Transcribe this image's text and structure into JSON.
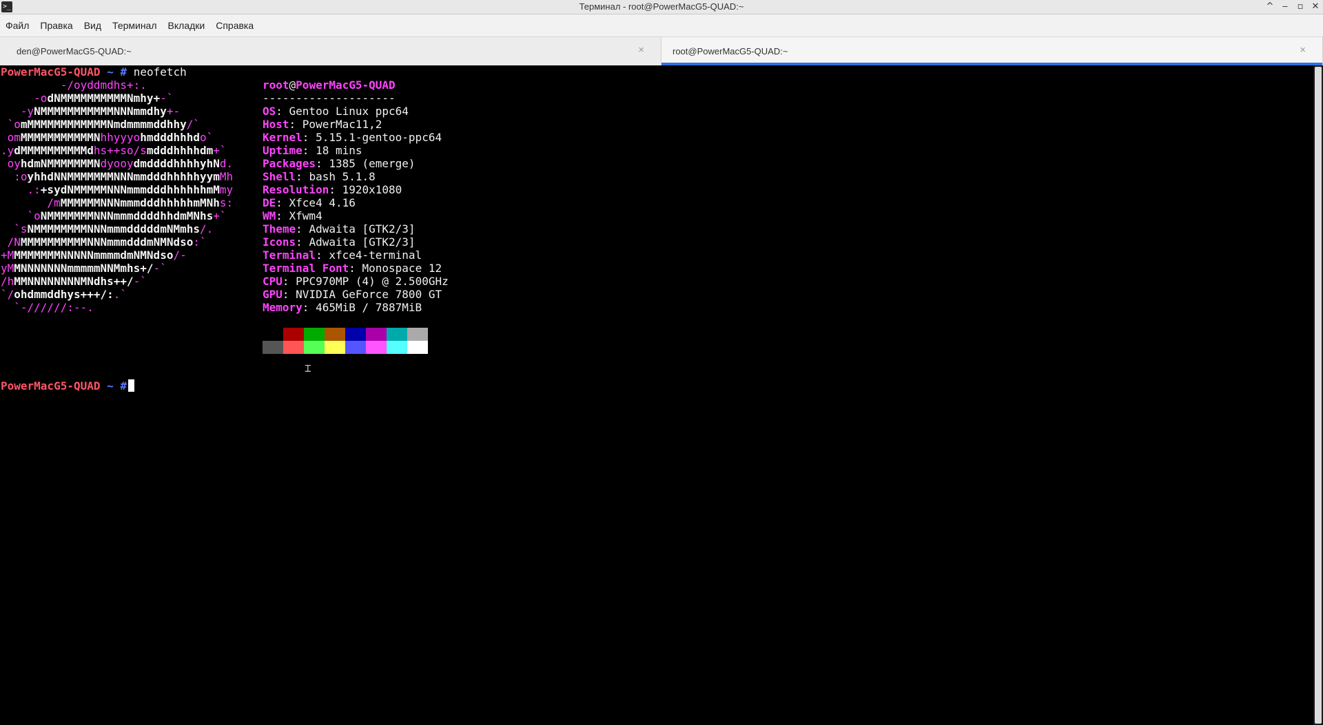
{
  "window": {
    "title": "Терминал - root@PowerMacG5-QUAD:~",
    "app_icon_glyph": ">_",
    "buttons": {
      "shade": "^",
      "minimize": "‒",
      "maximize": "▫",
      "close": "✕"
    }
  },
  "menu": [
    "Файл",
    "Правка",
    "Вид",
    "Терминал",
    "Вкладки",
    "Справка"
  ],
  "tabs": [
    {
      "label": "den@PowerMacG5-QUAD:~",
      "active": false,
      "close": "×"
    },
    {
      "label": "root@PowerMacG5-QUAD:~",
      "active": true,
      "close": "×"
    }
  ],
  "terminal": {
    "prompt_host": "PowerMacG5-QUAD",
    "prompt_tilde": "~",
    "prompt_hash": "#",
    "command": "neofetch",
    "logo_lines": [
      [
        [
          "m",
          "         -/oyddmdhs+:."
        ]
      ],
      [
        [
          "m",
          "     -o"
        ],
        [
          "w",
          "dNMMMMMMMMMMNmhy+"
        ],
        [
          "m",
          "-`"
        ]
      ],
      [
        [
          "m",
          "   -y"
        ],
        [
          "w",
          "NMMMMMMMMMMMNNNmmdhy"
        ],
        [
          "m",
          "+-"
        ]
      ],
      [
        [
          "m",
          " `o"
        ],
        [
          "w",
          "mMMMMMMMMMMMMNmdmmmmddhhy"
        ],
        [
          "m",
          "/`"
        ]
      ],
      [
        [
          "m",
          " om"
        ],
        [
          "w",
          "MMMMMMMMMMMN"
        ],
        [
          "m",
          "hhyyyo"
        ],
        [
          "w",
          "hmdddhhhd"
        ],
        [
          "m",
          "o`"
        ]
      ],
      [
        [
          "m",
          ".y"
        ],
        [
          "w",
          "dMMMMMMMMMMd"
        ],
        [
          "m",
          "hs++so/s"
        ],
        [
          "w",
          "mdddhhhhdm"
        ],
        [
          "m",
          "+`"
        ]
      ],
      [
        [
          "m",
          " oy"
        ],
        [
          "w",
          "hdmNMMMMMMMN"
        ],
        [
          "m",
          "dyooy"
        ],
        [
          "w",
          "dmddddhhhhyhN"
        ],
        [
          "m",
          "d."
        ]
      ],
      [
        [
          "m",
          "  :o"
        ],
        [
          "w",
          "yhhdNNMMMMMMMNNNmmdddhhhhhyym"
        ],
        [
          "m",
          "Mh"
        ]
      ],
      [
        [
          "m",
          "    .:"
        ],
        [
          "w",
          "+sydNMMMMMNNNmmmdddhhhhhhmM"
        ],
        [
          "m",
          "my"
        ]
      ],
      [
        [
          "m",
          "       /m"
        ],
        [
          "w",
          "MMMMMMNNNmmmdddhhhhhmMNh"
        ],
        [
          "m",
          "s:"
        ]
      ],
      [
        [
          "m",
          "    `o"
        ],
        [
          "w",
          "NMMMMMMMNNNmmmddddhhdmMNhs"
        ],
        [
          "m",
          "+`"
        ]
      ],
      [
        [
          "m",
          "  `s"
        ],
        [
          "w",
          "NMMMMMMMMNNNmmmdddddmNMmhs"
        ],
        [
          "m",
          "/."
        ]
      ],
      [
        [
          "m",
          " /N"
        ],
        [
          "w",
          "MMMMMMMMMMNNNmmmdddmNMNdso"
        ],
        [
          "m",
          ":`"
        ]
      ],
      [
        [
          "m",
          "+M"
        ],
        [
          "w",
          "MMMMMMMNNNNNmmmmdmNMNdso"
        ],
        [
          "m",
          "/-"
        ]
      ],
      [
        [
          "m",
          "yM"
        ],
        [
          "w",
          "MNNNNNNNmmmmmNNMmhs+/"
        ],
        [
          "m",
          "-`"
        ]
      ],
      [
        [
          "m",
          "/h"
        ],
        [
          "w",
          "MMNNNNNNNNMNdhs++/"
        ],
        [
          "m",
          "-`"
        ]
      ],
      [
        [
          "m",
          "`/"
        ],
        [
          "w",
          "ohdmmddhys+++/:"
        ],
        [
          "m",
          ".`"
        ]
      ],
      [
        [
          "m",
          "  `-//////:--."
        ]
      ]
    ],
    "info_user": "root",
    "info_at": "@",
    "info_host": "PowerMacG5-QUAD",
    "separator": "--------------------",
    "info": [
      {
        "key": "OS",
        "value": "Gentoo Linux ppc64"
      },
      {
        "key": "Host",
        "value": "PowerMac11,2"
      },
      {
        "key": "Kernel",
        "value": "5.15.1-gentoo-ppc64"
      },
      {
        "key": "Uptime",
        "value": "18 mins"
      },
      {
        "key": "Packages",
        "value": "1385 (emerge)"
      },
      {
        "key": "Shell",
        "value": "bash 5.1.8"
      },
      {
        "key": "Resolution",
        "value": "1920x1080"
      },
      {
        "key": "DE",
        "value": "Xfce4 4.16"
      },
      {
        "key": "WM",
        "value": "Xfwm4"
      },
      {
        "key": "Theme",
        "value": "Adwaita [GTK2/3]"
      },
      {
        "key": "Icons",
        "value": "Adwaita [GTK2/3]"
      },
      {
        "key": "Terminal",
        "value": "xfce4-terminal"
      },
      {
        "key": "Terminal Font",
        "value": "Monospace 12"
      },
      {
        "key": "CPU",
        "value": "PPC970MP (4) @ 2.500GHz"
      },
      {
        "key": "GPU",
        "value": "NVIDIA GeForce 7800 GT"
      },
      {
        "key": "Memory",
        "value": "465MiB / 7887MiB"
      }
    ],
    "palette_top": [
      "#000000",
      "#aa0000",
      "#00aa00",
      "#aa5500",
      "#0000aa",
      "#aa00aa",
      "#00aaaa",
      "#aaaaaa"
    ],
    "palette_bottom": [
      "#555555",
      "#ff5555",
      "#55ff55",
      "#ffff55",
      "#5555ff",
      "#ff55ff",
      "#55ffff",
      "#ffffff"
    ]
  }
}
